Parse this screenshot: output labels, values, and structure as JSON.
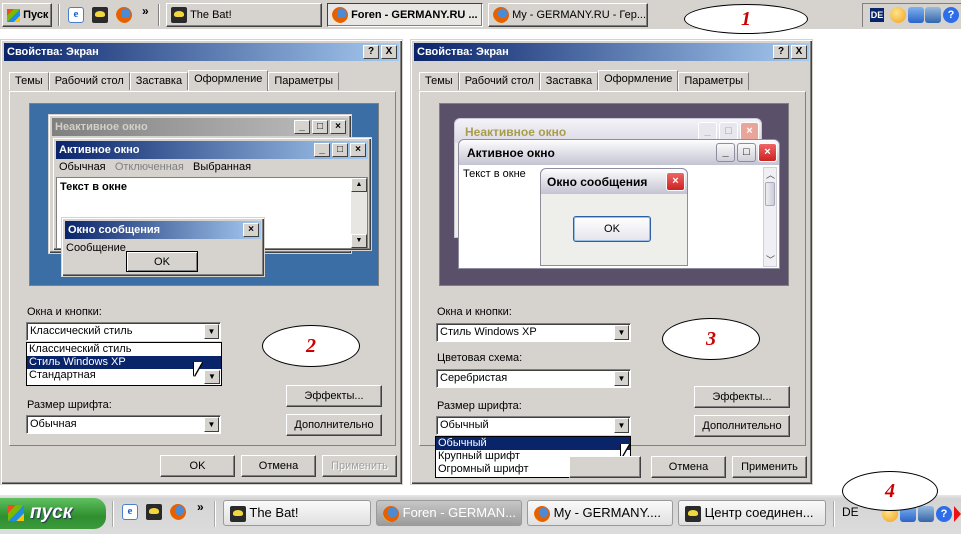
{
  "top_taskbar": {
    "start_label": "Пуск",
    "chevron": "»",
    "tasks": [
      {
        "label": "The Bat!",
        "icon": "bat-icon"
      },
      {
        "label": "Foren - GERMANY.RU ...",
        "icon": "firefox-icon",
        "active": true
      },
      {
        "label": "My - GERMANY.RU - Гер...",
        "icon": "firefox-icon"
      }
    ],
    "lang": "DE"
  },
  "callouts": {
    "c1": "1",
    "c2": "2",
    "c3": "3",
    "c4": "4"
  },
  "left_dialog": {
    "title": "Свойства: Экран",
    "help_btn": "?",
    "close_btn": "X",
    "tabs": [
      "Темы",
      "Рабочий стол",
      "Заставка",
      "Оформление",
      "Параметры"
    ],
    "active_tab": "Оформление",
    "preview": {
      "inactive_title": "Неактивное окно",
      "active_title": "Активное окно",
      "menu": [
        "Обычная",
        "Отключенная",
        "Выбранная"
      ],
      "body_text": "Текст в окне",
      "msg_title": "Окно сообщения",
      "msg_text": "Сообщение",
      "ok": "OK"
    },
    "windows_label": "Окна и кнопки:",
    "windows_value": "Классический стиль",
    "windows_options": [
      "Классический стиль",
      "Стиль Windows XP",
      "Стандартная"
    ],
    "windows_selected": "Стиль Windows XP",
    "font_label": "Размер шрифта:",
    "font_value": "Обычная",
    "effects": "Эффекты...",
    "advanced": "Дополнительно",
    "ok": "OK",
    "cancel": "Отмена",
    "apply": "Применить"
  },
  "right_dialog": {
    "title": "Свойства: Экран",
    "help_btn": "?",
    "close_btn": "X",
    "tabs": [
      "Темы",
      "Рабочий стол",
      "Заставка",
      "Оформление",
      "Параметры"
    ],
    "active_tab": "Оформление",
    "preview": {
      "inactive_title": "Неактивное окно",
      "active_title": "Активное окно",
      "body_text": "Текст в окне",
      "msg_title": "Окно сообщения",
      "ok": "OK"
    },
    "windows_label": "Окна и кнопки:",
    "windows_value": "Стиль Windows XP",
    "scheme_label": "Цветовая схема:",
    "scheme_value": "Серебристая",
    "font_label": "Размер шрифта:",
    "font_value": "Обычный",
    "font_options": [
      "Обычный",
      "Крупный шрифт",
      "Огромный шрифт"
    ],
    "font_selected": "Обычный",
    "effects": "Эффекты...",
    "advanced": "Дополнительно",
    "cancel": "Отмена",
    "apply": "Применить"
  },
  "bottom_taskbar": {
    "start_label": "пуск",
    "chevron": "»",
    "tasks": [
      {
        "label": "The Bat!",
        "icon": "bat-icon"
      },
      {
        "label": "Foren - GERMAN...",
        "icon": "firefox-icon",
        "active": true
      },
      {
        "label": "My - GERMANY....",
        "icon": "firefox-icon"
      },
      {
        "label": "Центр соединен...",
        "icon": "bat-icon"
      }
    ],
    "lang": "DE"
  },
  "colors": {
    "classic_title": "#0a246a",
    "xp_silver_title": "#d5d4df",
    "xp_start_green": "#3c9a3c",
    "callout_text": "#c00000"
  }
}
